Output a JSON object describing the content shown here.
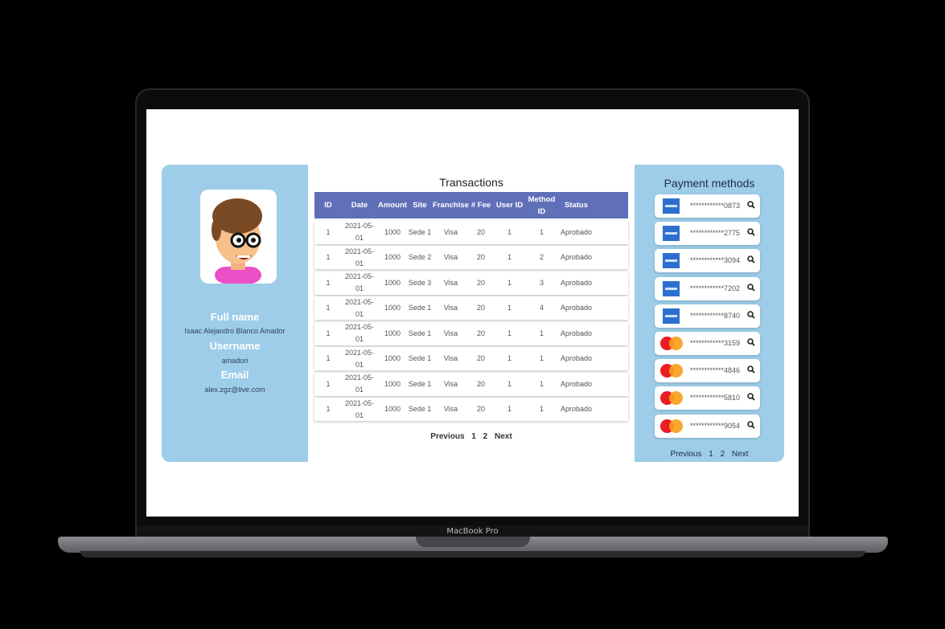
{
  "device_label": "MacBook Pro",
  "profile": {
    "fullname_label": "Full name",
    "fullname": "Isaac Alejandro Blanco Amador",
    "username_label": "Username",
    "username": "amadori",
    "email_label": "Email",
    "email": "alex.zgz@live.com"
  },
  "transactions": {
    "title": "Transactions",
    "columns": [
      "ID",
      "Date",
      "Amount",
      "Site",
      "Franchise",
      "# Fee",
      "User ID",
      "Method ID",
      "Status"
    ],
    "rows": [
      [
        "1",
        "2021-05-01",
        "1000",
        "Sede 1",
        "Visa",
        "20",
        "1",
        "1",
        "Aprobado"
      ],
      [
        "1",
        "2021-05-01",
        "1000",
        "Sede 2",
        "Visa",
        "20",
        "1",
        "2",
        "Aprobado"
      ],
      [
        "1",
        "2021-05-01",
        "1000",
        "Sede 3",
        "Visa",
        "20",
        "1",
        "3",
        "Aprobado"
      ],
      [
        "1",
        "2021-05-01",
        "1000",
        "Sede 1",
        "Visa",
        "20",
        "1",
        "4",
        "Aprobado"
      ],
      [
        "1",
        "2021-05-01",
        "1000",
        "Sede 1",
        "Visa",
        "20",
        "1",
        "1",
        "Aprobado"
      ],
      [
        "1",
        "2021-05-01",
        "1000",
        "Sede 1",
        "Visa",
        "20",
        "1",
        "1",
        "Aprobado"
      ],
      [
        "1",
        "2021-05-01",
        "1000",
        "Sede 1",
        "Visa",
        "20",
        "1",
        "1",
        "Aprobado"
      ],
      [
        "1",
        "2021-05-01",
        "1000",
        "Sede 1",
        "Visa",
        "20",
        "1",
        "1",
        "Aprobado"
      ]
    ],
    "pager": {
      "previous": "Previous",
      "page1": "1",
      "page2": "2",
      "next": "Next"
    }
  },
  "payment_methods": {
    "title": "Payment methods",
    "cards": [
      {
        "brand": "amex",
        "number": "************0873"
      },
      {
        "brand": "amex",
        "number": "************2775"
      },
      {
        "brand": "amex",
        "number": "************3094"
      },
      {
        "brand": "amex",
        "number": "************7202"
      },
      {
        "brand": "amex",
        "number": "************8740"
      },
      {
        "brand": "mastercard",
        "number": "************3159"
      },
      {
        "brand": "mastercard",
        "number": "************4846"
      },
      {
        "brand": "mastercard",
        "number": "************5810"
      },
      {
        "brand": "mastercard",
        "number": "************9054"
      }
    ],
    "pager": {
      "previous": "Previous",
      "page1": "1",
      "page2": "2",
      "next": "Next"
    }
  },
  "colors": {
    "panel": "#9dcde9",
    "table_header": "#5f6fb8"
  }
}
